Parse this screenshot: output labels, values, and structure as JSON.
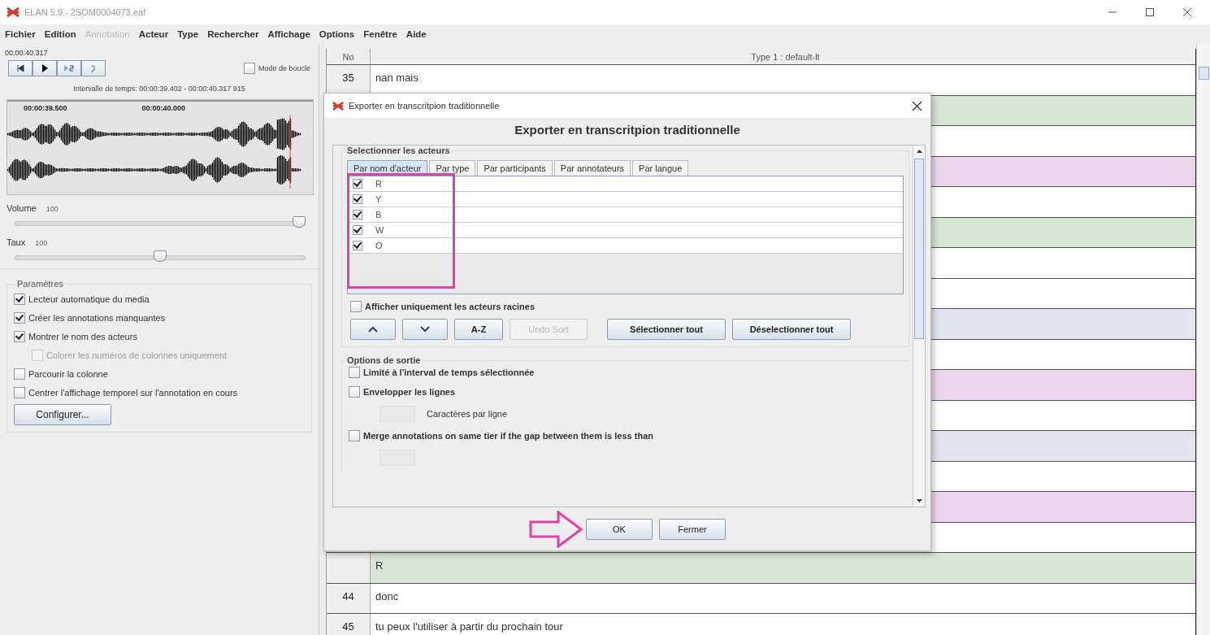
{
  "window": {
    "title": "ELAN 5.9 - 2SOM0004073.eaf"
  },
  "menu": [
    {
      "label": "Fichier",
      "disabled": false
    },
    {
      "label": "Edition",
      "disabled": false
    },
    {
      "label": "Annotation",
      "disabled": true
    },
    {
      "label": "Acteur",
      "disabled": false
    },
    {
      "label": "Type",
      "disabled": false
    },
    {
      "label": "Rechercher",
      "disabled": false
    },
    {
      "label": "Affichage",
      "disabled": false
    },
    {
      "label": "Options",
      "disabled": false
    },
    {
      "label": "Fenêtre",
      "disabled": false
    },
    {
      "label": "Aide",
      "disabled": false
    }
  ],
  "player": {
    "time": "00:00:40.317",
    "buttons": [
      {
        "kind": "go-begin"
      },
      {
        "kind": "play"
      },
      {
        "kind": "play-selection"
      },
      {
        "kind": "loop"
      }
    ],
    "loop_mode": {
      "label": "Mode de boucle",
      "checked": false
    },
    "interval": "Intervalle de temps: 00:00:39.402 - 00:00:40.317  915"
  },
  "waveform": {
    "ticks": [
      "00:00:39.500",
      "00:00:40.000"
    ]
  },
  "sliders": [
    {
      "label": "Volume",
      "reading": "100",
      "level": 1.0
    },
    {
      "label": "Taux",
      "reading": "100",
      "level": 0.5
    }
  ],
  "settings": {
    "title": "Paramètres",
    "options": [
      {
        "label": "Lecteur automatique du media",
        "checked": true,
        "disabled": false,
        "indent": false
      },
      {
        "label": "Créer les annotations manquantes",
        "checked": true,
        "disabled": false,
        "indent": false
      },
      {
        "label": "Montrer le nom des acteurs",
        "checked": true,
        "disabled": false,
        "indent": false
      },
      {
        "label": "Colorer les numéros de colonnes uniquement",
        "checked": false,
        "disabled": true,
        "indent": true
      },
      {
        "label": "Parcourir la colonne",
        "checked": false,
        "disabled": false,
        "indent": false
      },
      {
        "label": "Centrer l'affichage temporel sur l'annotation en cours",
        "checked": false,
        "disabled": false,
        "indent": false
      }
    ],
    "button": "Configurer..."
  },
  "table": {
    "columns": [
      "No",
      "Type 1 : default-lt"
    ],
    "rows": [
      {
        "no": "35",
        "text": "nan mais",
        "color": "#ffffff"
      },
      {
        "color": "#d8e4d6"
      },
      {
        "color": "#ffffff"
      },
      {
        "color": "#ecd5ea"
      },
      {
        "color": "#ffffff"
      },
      {
        "color": "#d8e4d6"
      },
      {
        "color": "#ffffff"
      },
      {
        "color": "#ffffff"
      },
      {
        "color": "#e4e4f0"
      },
      {
        "color": "#ffffff"
      },
      {
        "color": "#ecd5ea"
      },
      {
        "color": "#ffffff"
      },
      {
        "color": "#e4e4f0"
      },
      {
        "color": "#ffffff"
      },
      {
        "color": "#ecd5ea"
      },
      {
        "color": "#ffffff"
      },
      {
        "text": "R",
        "color": "#d8e4d6"
      },
      {
        "no": "44",
        "text": "donc",
        "color": "#ffffff"
      },
      {
        "no": "45",
        "text": "tu peux l'utiliser à partir du prochain tour",
        "color": "#ffffff"
      }
    ]
  },
  "dialog": {
    "title": "Exporter en transcritpion traditionnelle",
    "heading": "Exporter en transcritpion traditionnelle",
    "actors_group": {
      "title": "Selectionner les acteurs",
      "tabs": [
        {
          "label": "Par nom d'acteur",
          "selected": true
        },
        {
          "label": "Par type",
          "selected": false
        },
        {
          "label": "Par participants",
          "selected": false
        },
        {
          "label": "Par annotateurs",
          "selected": false
        },
        {
          "label": "Par langue",
          "selected": false
        }
      ],
      "actors": [
        {
          "name": "R",
          "checked": true
        },
        {
          "name": "Y",
          "checked": true
        },
        {
          "name": "B",
          "checked": true
        },
        {
          "name": "W",
          "checked": true
        },
        {
          "name": "O",
          "checked": true
        }
      ],
      "root_only": {
        "label": "Afficher uniquement les acteurs racines",
        "checked": false
      },
      "buttons": [
        {
          "kind": "up",
          "disabled": false
        },
        {
          "kind": "down",
          "disabled": false
        },
        {
          "kind": "text",
          "label": "A-Z",
          "disabled": false
        },
        {
          "kind": "text",
          "label": "Undo Sort",
          "disabled": true
        },
        {
          "kind": "text",
          "label": "Sélectionner tout",
          "disabled": false
        },
        {
          "kind": "text",
          "label": "Déselectionner tout",
          "disabled": false
        }
      ]
    },
    "output_group": {
      "title": "Options de sortie",
      "options": [
        {
          "kind": "checkbox",
          "label": "Limité à l'interval de temps sélectionnée",
          "checked": false
        },
        {
          "kind": "checkbox",
          "label": "Envelopper les lignes",
          "checked": false
        },
        {
          "kind": "field",
          "label": "Caractères par ligne"
        },
        {
          "kind": "checkbox",
          "label": "Merge annotations on same tier if the gap between them is less than",
          "checked": false
        },
        {
          "kind": "field"
        }
      ]
    },
    "buttons": [
      "OK",
      "Fermer"
    ]
  }
}
